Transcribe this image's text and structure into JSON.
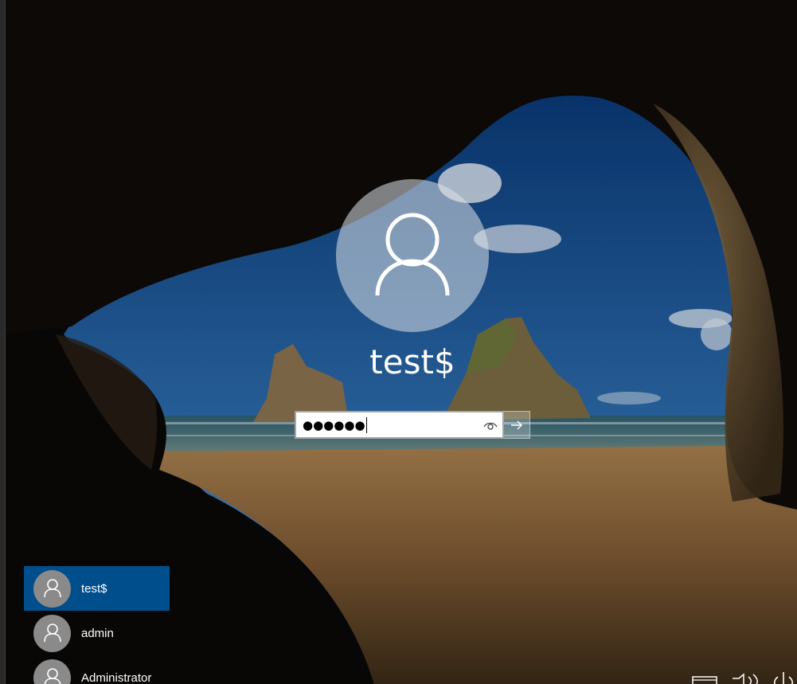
{
  "user": {
    "display_name": "test$"
  },
  "password": {
    "masked_value": "●●●●●●"
  },
  "user_list": [
    {
      "name": "test$",
      "selected": true
    },
    {
      "name": "admin",
      "selected": false
    },
    {
      "name": "Administrator",
      "selected": false
    }
  ],
  "icons": {
    "avatar": "person-icon",
    "reveal": "eye-icon",
    "submit": "arrow-right-icon",
    "ease_of_access": "ease-of-access-icon",
    "network": "network-icon",
    "power": "power-icon"
  },
  "colors": {
    "selected_user_bg": "#004e8c",
    "avatar_bg": "#8a8a8a"
  }
}
